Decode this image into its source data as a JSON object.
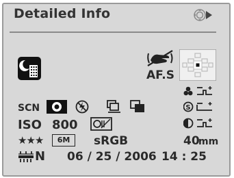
{
  "header": {
    "title": "Detailed Info",
    "dial_icon": "four-way-controller-icon"
  },
  "shooting": {
    "scene_mode_icon": "night-scene-portrait-icon",
    "shake_reduction_icon": "shake-reduction-hand-icon",
    "focus_mode": "AF.S",
    "af_point_icon": "af-point-grid-icon"
  },
  "settings_row1": {
    "scene_label": "SCN",
    "metering_icon": "center-weighted-metering-icon",
    "flash_icon": "flash-off-icon",
    "drive_icon": "continuous-shooting-icon",
    "bracket_icon": "multi-frame-icon"
  },
  "settings_row2": {
    "iso_label": "ISO",
    "iso_value": "800",
    "dfilter_icon": "digital-filter-icon"
  },
  "settings_row3": {
    "quality_label": "★★★",
    "size_label": "6M",
    "color_space": "sRGB",
    "focal_length": "40",
    "focal_unit": "mm"
  },
  "footer": {
    "white_balance_icon": "fluorescent-wb-icon",
    "white_balance_label": "N",
    "date": "06 / 25 / 2006",
    "time": "14 : 25"
  },
  "image_params": {
    "saturation_icon": "saturation-icon",
    "sharpness_icon": "sharpness-icon",
    "contrast_icon": "contrast-icon"
  },
  "colors": {
    "panel": "#d8d8d8",
    "text": "#2a2a2a",
    "border": "#9a9a9a"
  }
}
